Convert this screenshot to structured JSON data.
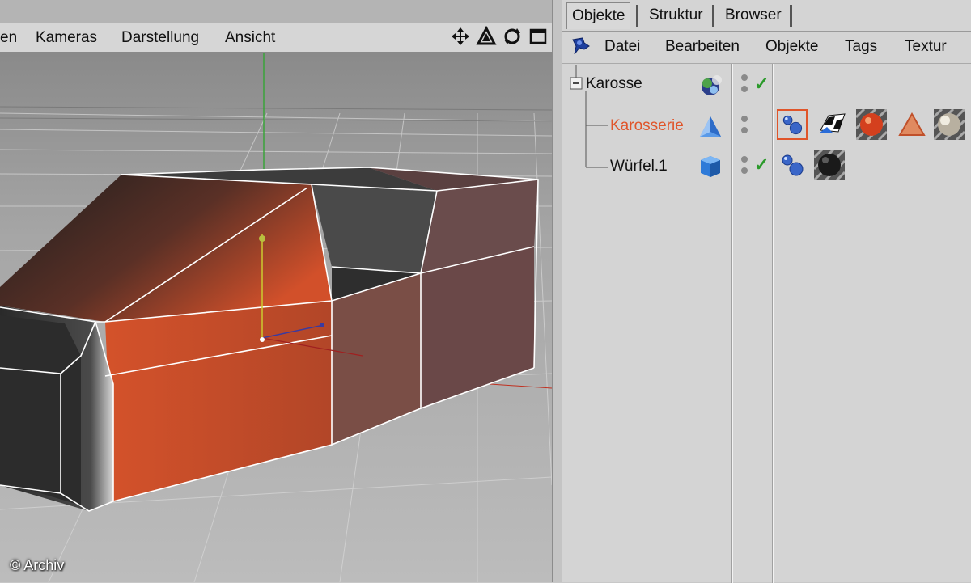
{
  "viewport": {
    "menu": [
      "en",
      "Kameras",
      "Darstellung",
      "Ansicht"
    ],
    "tools": [
      "move-icon",
      "scale-icon",
      "rotate-icon",
      "maximize-icon"
    ],
    "copyright": "© Archiv"
  },
  "object_manager": {
    "tabs": [
      "Objekte",
      "Struktur",
      "Browser"
    ],
    "active_tab": "Objekte",
    "menu": [
      "Datei",
      "Bearbeiten",
      "Objekte",
      "Tags",
      "Textur"
    ],
    "objects": [
      {
        "name": "Karosse",
        "icon": "group-null-icon",
        "enabled": true,
        "selected": false,
        "tags": []
      },
      {
        "name": "Karosserie",
        "icon": "polygon-object-icon",
        "enabled": false,
        "selected": true,
        "tags": [
          "phong-tag-icon",
          "uvw-tag-icon",
          "material-orange-tag-icon",
          "selection-tag-icon",
          "material-sky-tag-icon"
        ]
      },
      {
        "name": "Würfel.1",
        "icon": "cube-icon",
        "enabled": true,
        "selected": false,
        "tags": [
          "phong-tag-icon",
          "material-black-tag-icon"
        ]
      }
    ]
  },
  "colors": {
    "selected_text": "#e0552a",
    "body_orange": "#d2502a",
    "body_dark": "#2a2a2a"
  }
}
